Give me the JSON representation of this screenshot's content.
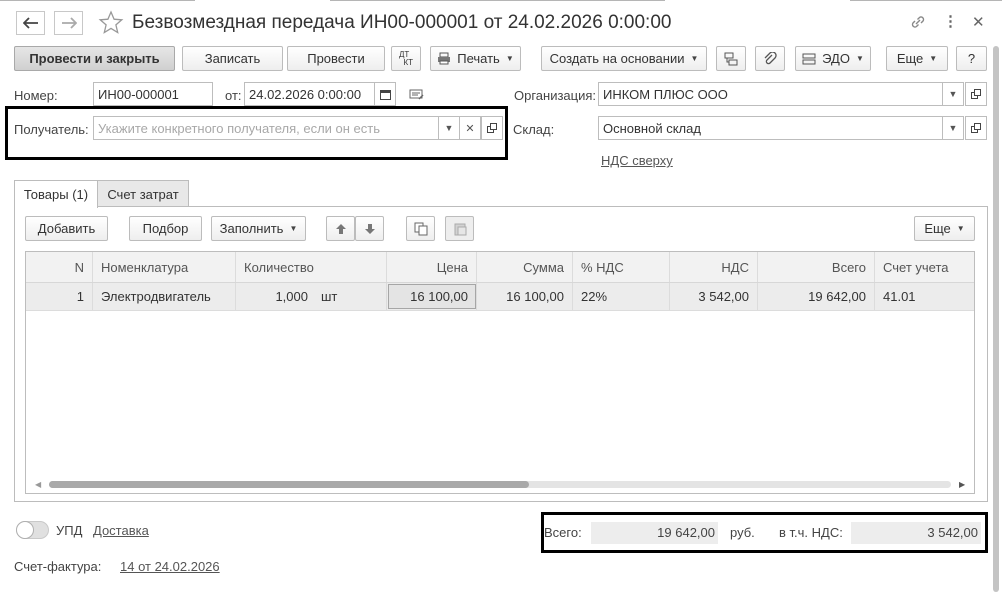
{
  "window": {
    "title": "Безвозмездная передача ИН00-000001 от 24.02.2026 0:00:00"
  },
  "toolbar": {
    "post_close": "Провести и закрыть",
    "save": "Записать",
    "post": "Провести",
    "dt_kt": "ДТ КТ",
    "print": "Печать",
    "create_based": "Создать на основании",
    "edo": "ЭДО",
    "more": "Еще",
    "help": "?"
  },
  "form": {
    "number_label": "Номер:",
    "number_value": "ИН00-000001",
    "date_label": "от:",
    "date_value": "24.02.2026  0:00:00",
    "org_label": "Организация:",
    "org_value": "ИНКОМ ПЛЮС ООО",
    "recipient_label": "Получатель:",
    "recipient_placeholder": "Укажите конкретного получателя, если он есть",
    "warehouse_label": "Склад:",
    "warehouse_value": "Основной склад",
    "vat_link": "НДС сверху"
  },
  "tabs": [
    {
      "label": "Товары (1)",
      "active": true
    },
    {
      "label": "Счет затрат",
      "active": false
    }
  ],
  "table_toolbar": {
    "add": "Добавить",
    "select": "Подбор",
    "fill": "Заполнить",
    "more": "Еще"
  },
  "table": {
    "columns": [
      "N",
      "Номенклатура",
      "Количество",
      "Цена",
      "Сумма",
      "% НДС",
      "НДС",
      "Всего",
      "Счет учета"
    ],
    "rows": [
      {
        "n": "1",
        "item": "Электродвигатель",
        "qty": "1,000",
        "unit": "шт",
        "price": "16 100,00",
        "sum": "16 100,00",
        "vat_rate": "22%",
        "vat": "3 542,00",
        "total": "19 642,00",
        "account": "41.01"
      }
    ]
  },
  "footer": {
    "upd_label": "УПД",
    "delivery_link": "Доставка",
    "invoice_label": "Счет-фактура:",
    "invoice_link": "14 от 24.02.2026",
    "total_label": "Всего:",
    "total_value": "19 642,00",
    "currency": "руб.",
    "vat_incl_label": "в т.ч. НДС:",
    "vat_value": "3 542,00"
  }
}
